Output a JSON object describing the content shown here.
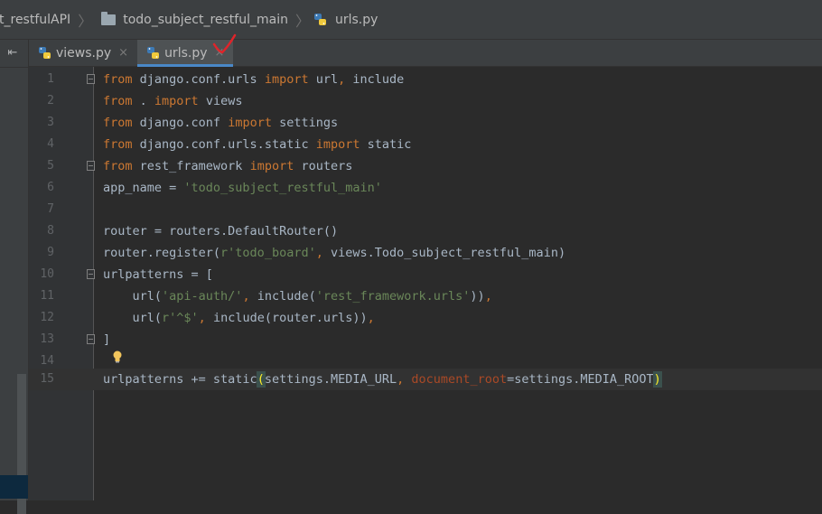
{
  "breadcrumb": {
    "items": [
      {
        "label": "t_restfulAPI",
        "icon": "none"
      },
      {
        "label": "todo_subject_restful_main",
        "icon": "folder-icon"
      },
      {
        "label": "urls.py",
        "icon": "python-file-icon"
      }
    ]
  },
  "tabs": [
    {
      "label": "views.py",
      "active": false,
      "close": "×"
    },
    {
      "label": "urls.py",
      "active": true,
      "close": "×"
    }
  ],
  "editor": {
    "lines": [
      {
        "num": "1",
        "fold": true
      },
      {
        "num": "2"
      },
      {
        "num": "3"
      },
      {
        "num": "4"
      },
      {
        "num": "5",
        "fold": true
      },
      {
        "num": "6"
      },
      {
        "num": "7"
      },
      {
        "num": "8"
      },
      {
        "num": "9"
      },
      {
        "num": "10",
        "fold": true
      },
      {
        "num": "11"
      },
      {
        "num": "12"
      },
      {
        "num": "13",
        "fold": true
      },
      {
        "num": "14"
      },
      {
        "num": "15",
        "current": true
      }
    ],
    "tokens": {
      "l1": [
        "from",
        " django.conf.urls ",
        "import",
        " url",
        ",",
        " include"
      ],
      "l2": [
        "from",
        " . ",
        "import",
        " views"
      ],
      "l3": [
        "from",
        " django.conf ",
        "import",
        " settings"
      ],
      "l4": [
        "from",
        " django.conf.urls.static ",
        "import",
        " static"
      ],
      "l5": [
        "from",
        " rest_framework ",
        "import",
        " routers"
      ],
      "l6": [
        "app_name = ",
        "'todo_subject_restful_main'"
      ],
      "l8": [
        "router = routers.DefaultRouter()"
      ],
      "l9": [
        "router.register(",
        "r'todo_board'",
        ",",
        " views.Todo_subject_restful_main)"
      ],
      "l10": [
        "urlpatterns = ["
      ],
      "l11": [
        "    url(",
        "'api-auth/'",
        ",",
        " include(",
        "'rest_framework.urls'",
        "))",
        ","
      ],
      "l12": [
        "    url(",
        "r'^$'",
        ",",
        " include(router.urls))",
        ","
      ],
      "l13": [
        "]"
      ],
      "l15": [
        "urlpatterns += static",
        "(",
        "settings.MEDIA_URL",
        ",",
        " ",
        "document_root",
        "=settings.MEDIA_ROOT",
        ")"
      ]
    }
  },
  "colors": {
    "keyword": "#cc7832",
    "string": "#6a8759",
    "param": "#aa4926",
    "text": "#a9b7c6",
    "tab_underline": "#4a88c7",
    "annotation_check": "#e0242a"
  }
}
